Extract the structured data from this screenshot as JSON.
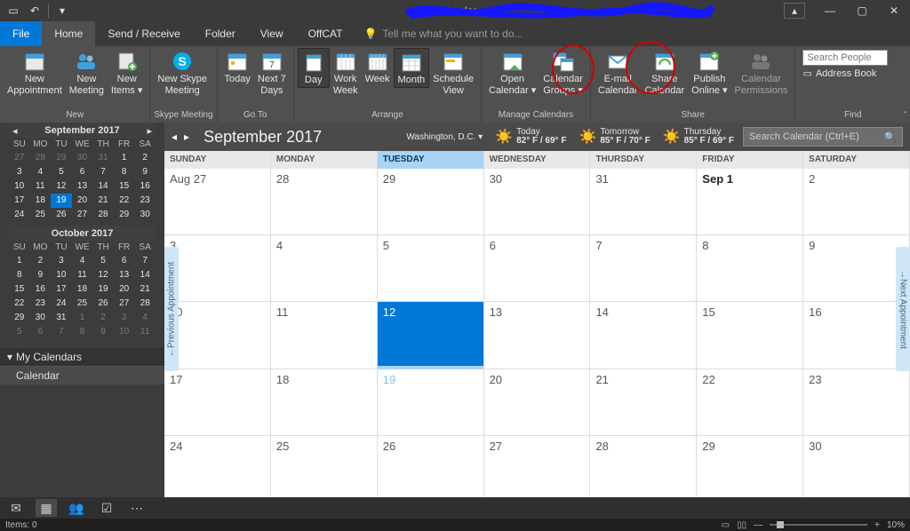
{
  "title": "Calendar",
  "tabs": {
    "file": "File",
    "home": "Home",
    "sendrecv": "Send / Receive",
    "folder": "Folder",
    "view": "View",
    "offcat": "OffCAT",
    "tell": "Tell me what you want to do..."
  },
  "ribbon": {
    "new": {
      "label": "New",
      "appt_l1": "New",
      "appt_l2": "Appointment",
      "mtg_l1": "New",
      "mtg_l2": "Meeting",
      "items_l1": "New",
      "items_l2": "Items ▾"
    },
    "skype": {
      "label": "Skype Meeting",
      "l1": "New Skype",
      "l2": "Meeting"
    },
    "goto": {
      "label": "Go To",
      "today": "Today",
      "n7_l1": "Next 7",
      "n7_l2": "Days"
    },
    "arrange": {
      "label": "Arrange",
      "day": "Day",
      "ww_l1": "Work",
      "ww_l2": "Week",
      "week": "Week",
      "month": "Month",
      "sv_l1": "Schedule",
      "sv_l2": "View"
    },
    "manage": {
      "label": "Manage Calendars",
      "open_l1": "Open",
      "open_l2": "Calendar ▾",
      "grp_l1": "Calendar",
      "grp_l2": "Groups ▾"
    },
    "share": {
      "label": "Share",
      "em_l1": "E-mail",
      "em_l2": "Calendar",
      "sh_l1": "Share",
      "sh_l2": "Calendar",
      "pub_l1": "Publish",
      "pub_l2": "Online ▾",
      "perm_l1": "Calendar",
      "perm_l2": "Permissions"
    },
    "find": {
      "label": "Find",
      "placeholder": "Search People",
      "ab": "Address Book"
    }
  },
  "mini1": {
    "title": "September 2017",
    "dow": [
      "SU",
      "MO",
      "TU",
      "WE",
      "TH",
      "FR",
      "SA"
    ],
    "rows": [
      [
        "27",
        "28",
        "29",
        "30",
        "31",
        "1",
        "2"
      ],
      [
        "3",
        "4",
        "5",
        "6",
        "7",
        "8",
        "9"
      ],
      [
        "10",
        "11",
        "12",
        "13",
        "14",
        "15",
        "16"
      ],
      [
        "17",
        "18",
        "19",
        "20",
        "21",
        "22",
        "23"
      ],
      [
        "24",
        "25",
        "26",
        "27",
        "28",
        "29",
        "30"
      ]
    ],
    "dimRow0": 5,
    "today": "19"
  },
  "mini2": {
    "title": "October 2017",
    "dow": [
      "SU",
      "MO",
      "TU",
      "WE",
      "TH",
      "FR",
      "SA"
    ],
    "rows": [
      [
        "1",
        "2",
        "3",
        "4",
        "5",
        "6",
        "7"
      ],
      [
        "8",
        "9",
        "10",
        "11",
        "12",
        "13",
        "14"
      ],
      [
        "15",
        "16",
        "17",
        "18",
        "19",
        "20",
        "21"
      ],
      [
        "22",
        "23",
        "24",
        "25",
        "26",
        "27",
        "28"
      ],
      [
        "29",
        "30",
        "31",
        "1",
        "2",
        "3",
        "4"
      ],
      [
        "5",
        "6",
        "7",
        "8",
        "9",
        "10",
        "11"
      ]
    ],
    "dimFromRow": 4,
    "dimFromCol": 3
  },
  "myCal": {
    "header": "My Calendars",
    "item": "Calendar"
  },
  "bigcal": {
    "month": "September 2017",
    "location": "Washington,  D.C.  ▾",
    "weather": [
      {
        "label": "Today",
        "temp": "82° F / 69° F"
      },
      {
        "label": "Tomorrow",
        "temp": "85° F / 70° F"
      },
      {
        "label": "Thursday",
        "temp": "85° F / 69° F"
      }
    ],
    "search_placeholder": "Search Calendar (Ctrl+E)",
    "dow": [
      "SUNDAY",
      "MONDAY",
      "TUESDAY",
      "WEDNESDAY",
      "THURSDAY",
      "FRIDAY",
      "SATURDAY"
    ],
    "weeks": [
      [
        "Aug 27",
        "28",
        "29",
        "30",
        "31",
        "Sep 1",
        "2"
      ],
      [
        "3",
        "4",
        "5",
        "6",
        "7",
        "8",
        "9"
      ],
      [
        "10",
        "11",
        "12",
        "13",
        "14",
        "15",
        "16"
      ],
      [
        "17",
        "18",
        "19",
        "20",
        "21",
        "22",
        "23"
      ],
      [
        "24",
        "25",
        "26",
        "27",
        "28",
        "29",
        "30"
      ]
    ],
    "today_idx": [
      2,
      2
    ],
    "today_day": "19",
    "bold_idx": [
      0,
      5
    ],
    "prev": "Previous Appointment",
    "next": "Next Appointment"
  },
  "status": {
    "items": "Items: 0",
    "zoom": "10%"
  }
}
